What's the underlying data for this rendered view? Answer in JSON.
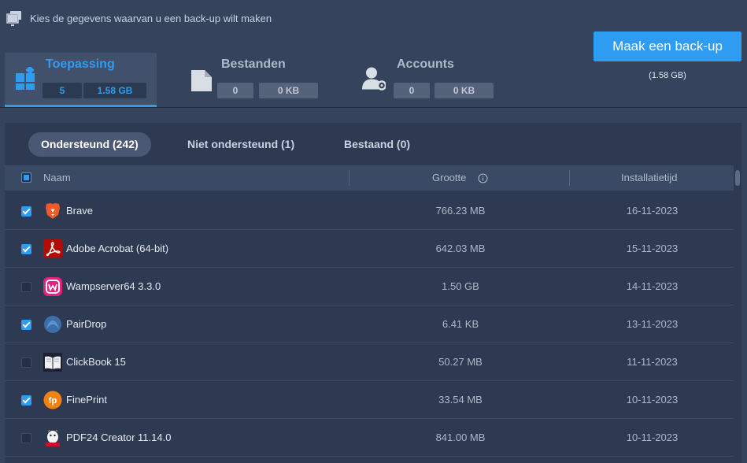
{
  "header": {
    "subtitle": "Kies de gegevens waarvan u een back-up wilt maken",
    "window_icon": "window-copy-icon"
  },
  "categories": [
    {
      "label": "Toepassing",
      "count": "5",
      "size": "1.58 GB",
      "icon": "apps-grid-icon",
      "active": true
    },
    {
      "label": "Bestanden",
      "count": "0",
      "size": "0 KB",
      "icon": "file-icon",
      "active": false
    },
    {
      "label": "Accounts",
      "count": "0",
      "size": "0 KB",
      "icon": "user-gear-icon",
      "active": false
    }
  ],
  "backup": {
    "button_label": "Maak een back-up",
    "total_size": "(1.58 GB)"
  },
  "filters": [
    {
      "label": "Ondersteund (242)",
      "active": true
    },
    {
      "label": "Niet ondersteund (1)",
      "active": false
    },
    {
      "label": "Bestaand (0)",
      "active": false
    }
  ],
  "table": {
    "columns": {
      "name": "Naam",
      "size": "Grootte",
      "date": "Installatietijd"
    },
    "select_all_state": "partial",
    "rows": [
      {
        "name": "Brave",
        "size": "766.23 MB",
        "date": "16-11-2023",
        "checked": true,
        "icon": "brave-lion-icon"
      },
      {
        "name": "Adobe Acrobat (64-bit)",
        "size": "642.03 MB",
        "date": "15-11-2023",
        "checked": true,
        "icon": "acrobat-icon"
      },
      {
        "name": "Wampserver64 3.3.0",
        "size": "1.50 GB",
        "date": "14-11-2023",
        "checked": false,
        "icon": "wampserver-icon"
      },
      {
        "name": "PairDrop",
        "size": "6.41 KB",
        "date": "13-11-2023",
        "checked": true,
        "icon": "pairdrop-icon"
      },
      {
        "name": "ClickBook 15",
        "size": "50.27 MB",
        "date": "11-11-2023",
        "checked": false,
        "icon": "open-book-icon"
      },
      {
        "name": "FinePrint",
        "size": "33.54 MB",
        "date": "10-11-2023",
        "checked": true,
        "icon": "fineprint-icon"
      },
      {
        "name": "PDF24 Creator 11.14.0",
        "size": "841.00 MB",
        "date": "10-11-2023",
        "checked": false,
        "icon": "pdf24-goat-icon"
      }
    ]
  },
  "colors": {
    "accent": "#2f9cf4",
    "background": "#35435c",
    "panel": "#2d3a51"
  }
}
